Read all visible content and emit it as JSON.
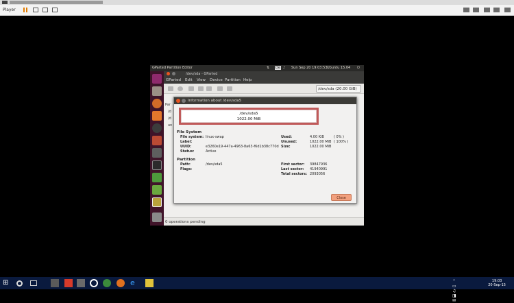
{
  "player": {
    "menu_label": "Player"
  },
  "guest_topbar": {
    "app_name": "GParted Partition Editor",
    "indicator_lang": "De",
    "datetime": "Sun Sep 20  19:03:53",
    "user": "Ubuntu 15.04"
  },
  "gparted": {
    "window_title": "/dev/sda - GParted",
    "menu": [
      "GParted",
      "Edit",
      "View",
      "Device",
      "Partition",
      "Help"
    ],
    "device_select": "/dev/sda  (20.00 GiB)",
    "status": "0 operations pending",
    "partial_labels": [
      "Par",
      "/d",
      "/d",
      "un"
    ]
  },
  "dialog": {
    "title": "Information about /dev/sda5",
    "partition_name": "/dev/sda5",
    "partition_size": "1022.00 MiB",
    "filesystem": {
      "heading": "File System",
      "labels": [
        "File system:",
        "Label:",
        "UUID:",
        "Status:"
      ],
      "values": [
        "linux-swap",
        "",
        "e3260e19-447a-4963-8a63-f6d1b38c770d",
        "Active"
      ],
      "usage_labels": [
        "Used:",
        "Unused:",
        "Size:"
      ],
      "usage_values": [
        "4.00 KiB",
        "1022.00 MiB",
        "1022.00 MiB"
      ],
      "usage_pct": [
        "( 0% )",
        "( 100% )",
        ""
      ]
    },
    "partition": {
      "heading": "Partition",
      "labels": [
        "Path:",
        "Flags:"
      ],
      "values": [
        "/dev/sda5",
        ""
      ],
      "sector_labels": [
        "First sector:",
        "Last sector:",
        "Total sectors:"
      ],
      "sector_values": [
        "39847936",
        "41940991",
        "2093056"
      ]
    },
    "close_label": "Close"
  },
  "taskbar": {
    "time": "19:03",
    "date": "20-Sep-15"
  },
  "colors": {
    "ubuntu_orange": "#e95420",
    "highlight_border": "#c05a5a",
    "windows_taskbar": "#0a1a3e"
  }
}
